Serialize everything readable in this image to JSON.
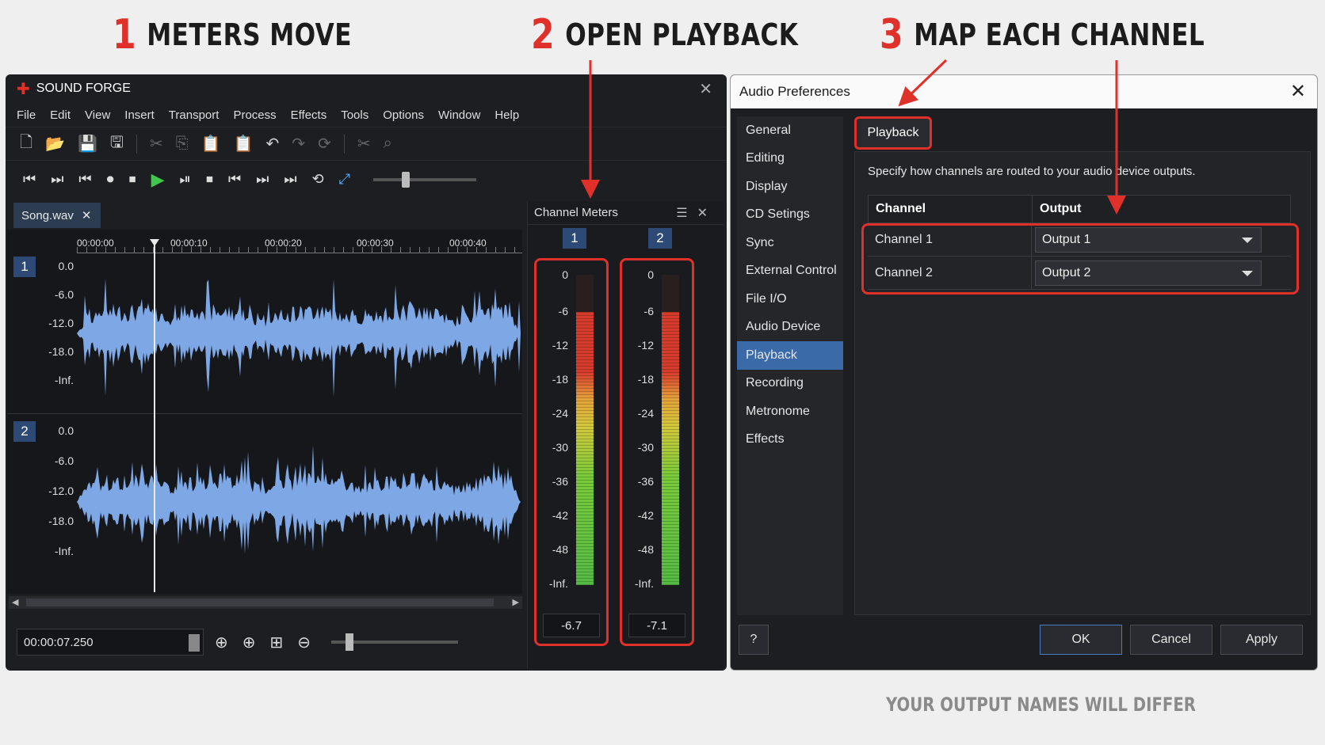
{
  "callouts": [
    {
      "num": "1",
      "text": "METERS MOVE"
    },
    {
      "num": "2",
      "text": "OPEN PLAYBACK"
    },
    {
      "num": "3",
      "text": "MAP EACH CHANNEL"
    }
  ],
  "footnote": "YOUR OUTPUT NAMES WILL DIFFER",
  "soundforge": {
    "title": "SOUND FORGE",
    "menu": [
      "File",
      "Edit",
      "View",
      "Insert",
      "Transport",
      "Process",
      "Effects",
      "Tools",
      "Options",
      "Window",
      "Help"
    ],
    "doc_tab": "Song.wav",
    "ruler": [
      "00:00:00",
      "00:00:10",
      "00:00:20",
      "00:00:30",
      "00:00:40"
    ],
    "channels": [
      {
        "badge": "1",
        "db_labels": [
          "0.0",
          "-6.0",
          "-12.0",
          "-18.0",
          "-Inf."
        ]
      },
      {
        "badge": "2",
        "db_labels": [
          "0.0",
          "-6.0",
          "-12.0",
          "-18.0",
          "-Inf."
        ]
      }
    ],
    "time": "00:00:07.250"
  },
  "channel_meters": {
    "title": "Channel Meters",
    "scale": [
      "0",
      "-6",
      "-12",
      "-18",
      "-24",
      "-30",
      "-36",
      "-42",
      "-48",
      "-Inf."
    ],
    "meters": [
      {
        "badge": "1",
        "value": "-6.7",
        "level": 0.88
      },
      {
        "badge": "2",
        "value": "-7.1",
        "level": 0.88
      }
    ]
  },
  "audio_prefs": {
    "title": "Audio Preferences",
    "nav": [
      "General",
      "Editing",
      "Display",
      "CD Setings",
      "Sync",
      "External Control",
      "File I/O",
      "Audio Device",
      "Playback",
      "Recording",
      "Metronome",
      "Effects"
    ],
    "active_nav": "Playback",
    "tab": "Playback",
    "description": "Specify how channels are routed to your audio device outputs.",
    "headers": [
      "Channel",
      "Output"
    ],
    "rows": [
      {
        "channel": "Channel 1",
        "output": "Output 1"
      },
      {
        "channel": "Channel 2",
        "output": "Output 2"
      }
    ],
    "help": "?",
    "buttons": {
      "ok": "OK",
      "cancel": "Cancel",
      "apply": "Apply"
    }
  },
  "colors": {
    "accent_red": "#e0302a",
    "nav_active": "#3b6aa8",
    "wave": "#7ea7e6"
  }
}
